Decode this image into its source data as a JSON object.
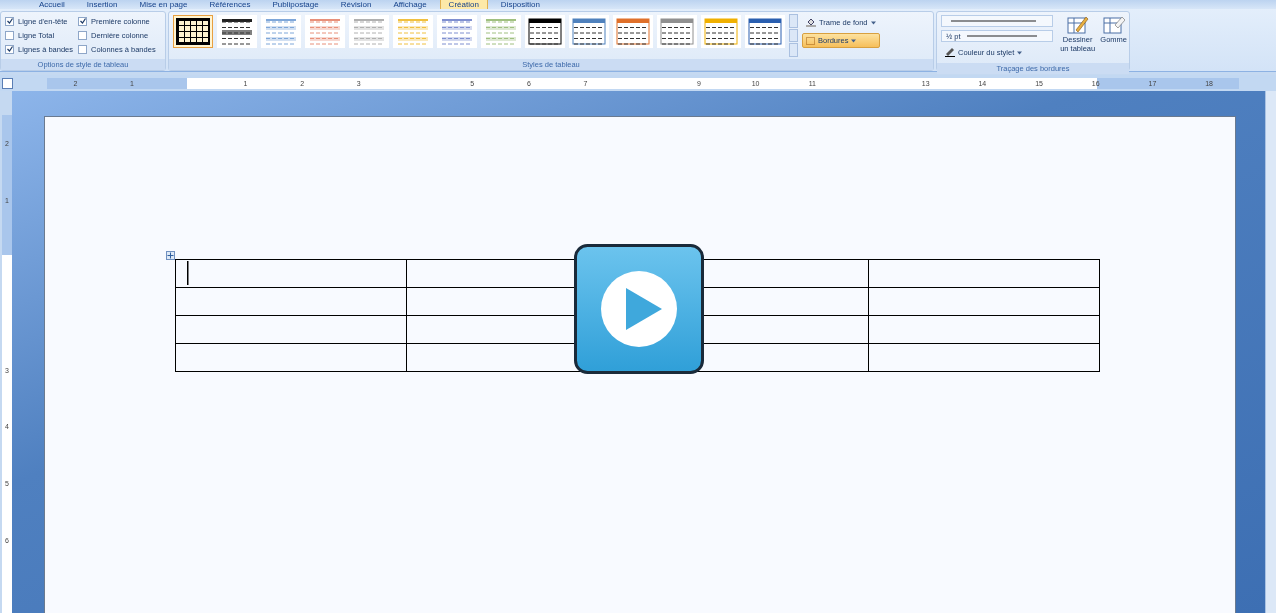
{
  "tabs": [
    {
      "label": "Accueil",
      "selected": false
    },
    {
      "label": "Insertion",
      "selected": false
    },
    {
      "label": "Mise en page",
      "selected": false
    },
    {
      "label": "Références",
      "selected": false
    },
    {
      "label": "Publipostage",
      "selected": false
    },
    {
      "label": "Révision",
      "selected": false
    },
    {
      "label": "Affichage",
      "selected": false
    },
    {
      "label": "Création",
      "selected": true
    },
    {
      "label": "Disposition",
      "selected": false
    }
  ],
  "style_options": {
    "title": "Options de style de tableau",
    "options": [
      {
        "label": "Ligne d'en-tête",
        "checked": true
      },
      {
        "label": "Ligne Total",
        "checked": false
      },
      {
        "label": "Lignes à bandes",
        "checked": true
      },
      {
        "label": "Première colonne",
        "checked": true
      },
      {
        "label": "Dernière colonne",
        "checked": false
      },
      {
        "label": "Colonnes à bandes",
        "checked": false
      }
    ]
  },
  "table_styles": {
    "title": "Styles de tableau",
    "styles": [
      {
        "kind": "grid",
        "color": "#000000",
        "selected": true
      },
      {
        "kind": "shaded",
        "color": "#808080",
        "selected": false
      },
      {
        "kind": "light",
        "color": "#7fa7d9",
        "selected": false
      },
      {
        "kind": "light",
        "color": "#e8907a",
        "selected": false
      },
      {
        "kind": "light",
        "color": "#b0b0b0",
        "selected": false
      },
      {
        "kind": "light",
        "color": "#f0c040",
        "selected": false
      },
      {
        "kind": "light",
        "color": "#7f8fd0",
        "selected": false
      },
      {
        "kind": "light",
        "color": "#a0c080",
        "selected": false
      },
      {
        "kind": "header",
        "color": "#000000",
        "selected": false
      },
      {
        "kind": "header",
        "color": "#4f81bd",
        "selected": false
      },
      {
        "kind": "header",
        "color": "#e0702a",
        "selected": false
      },
      {
        "kind": "header",
        "color": "#909090",
        "selected": false
      },
      {
        "kind": "header",
        "color": "#f0b000",
        "selected": false
      },
      {
        "kind": "header",
        "color": "#2a5fb0",
        "selected": false
      }
    ],
    "shading": "Trame de fond",
    "borders": "Bordures"
  },
  "border_drawing": {
    "title": "Traçage des bordures",
    "weight": "½ pt",
    "pen_color": "Couleur du stylet",
    "draw_table": "Dessiner un tableau",
    "eraser": "Gomme"
  },
  "ruler": {
    "horizontal": [
      "2",
      "1",
      "1",
      "2",
      "3",
      "5",
      "6",
      "7",
      "9",
      "10",
      "11",
      "13",
      "14",
      "15",
      "16",
      "17",
      "18"
    ],
    "vertical": [
      "2",
      "1",
      "3",
      "4",
      "5",
      "6"
    ]
  }
}
